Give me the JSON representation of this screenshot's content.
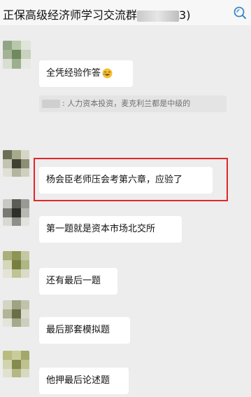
{
  "header": {
    "title_left": "正保高级经济师学习交流群",
    "title_right": "3)",
    "search_icon": "search-chat-icon"
  },
  "messages": [
    {
      "id": "m1",
      "text": "全凭经验作答",
      "emoji": "laughing-emoji-icon",
      "quote": {
        "text": "人力资本投资，麦克利兰都是中级的",
        "prefix": ": "
      }
    },
    {
      "id": "m2",
      "text": "杨会臣老师压会考第六章，应验了",
      "highlighted": true
    },
    {
      "id": "m3",
      "text": "第一题就是资本市场北交所"
    },
    {
      "id": "m4",
      "text": "还有最后一题"
    },
    {
      "id": "m5",
      "text": "最后那套模拟题"
    },
    {
      "id": "m6",
      "text": "他押最后论述题"
    }
  ],
  "colors": {
    "background": "#ededed",
    "bubble": "#ffffff",
    "highlight_border": "#e3262a",
    "quote_bg": "#e4e4e4",
    "accent_icon": "#3a87c8"
  }
}
